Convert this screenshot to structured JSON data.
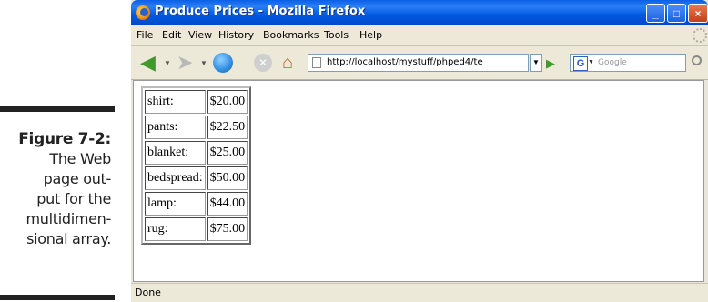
{
  "figure": {
    "number": "Figure 7-2:",
    "caption_lines": [
      "The Web",
      "page out-",
      "put for the",
      "multidimen-",
      "sional array."
    ]
  },
  "window": {
    "title": "Produce Prices - Mozilla Firefox",
    "controls": {
      "minimize": "_",
      "maximize": "□",
      "close": "×"
    }
  },
  "menu": [
    "File",
    "Edit",
    "View",
    "History",
    "Bookmarks",
    "Tools",
    "Help"
  ],
  "toolbar": {
    "url": "http://localhost/mystuff/phped4/te",
    "search_placeholder": "Google",
    "search_engine": "G"
  },
  "table": {
    "rows": [
      [
        "shirt:",
        "$20.00"
      ],
      [
        "pants:",
        "$22.50"
      ],
      [
        "blanket:",
        "$25.00"
      ],
      [
        "bedspread:",
        "$50.00"
      ],
      [
        "lamp:",
        "$44.00"
      ],
      [
        "rug:",
        "$75.00"
      ]
    ]
  },
  "status": "Done",
  "colors": {
    "titlebar": "#0058e0",
    "chrome": "#ece9d8"
  }
}
